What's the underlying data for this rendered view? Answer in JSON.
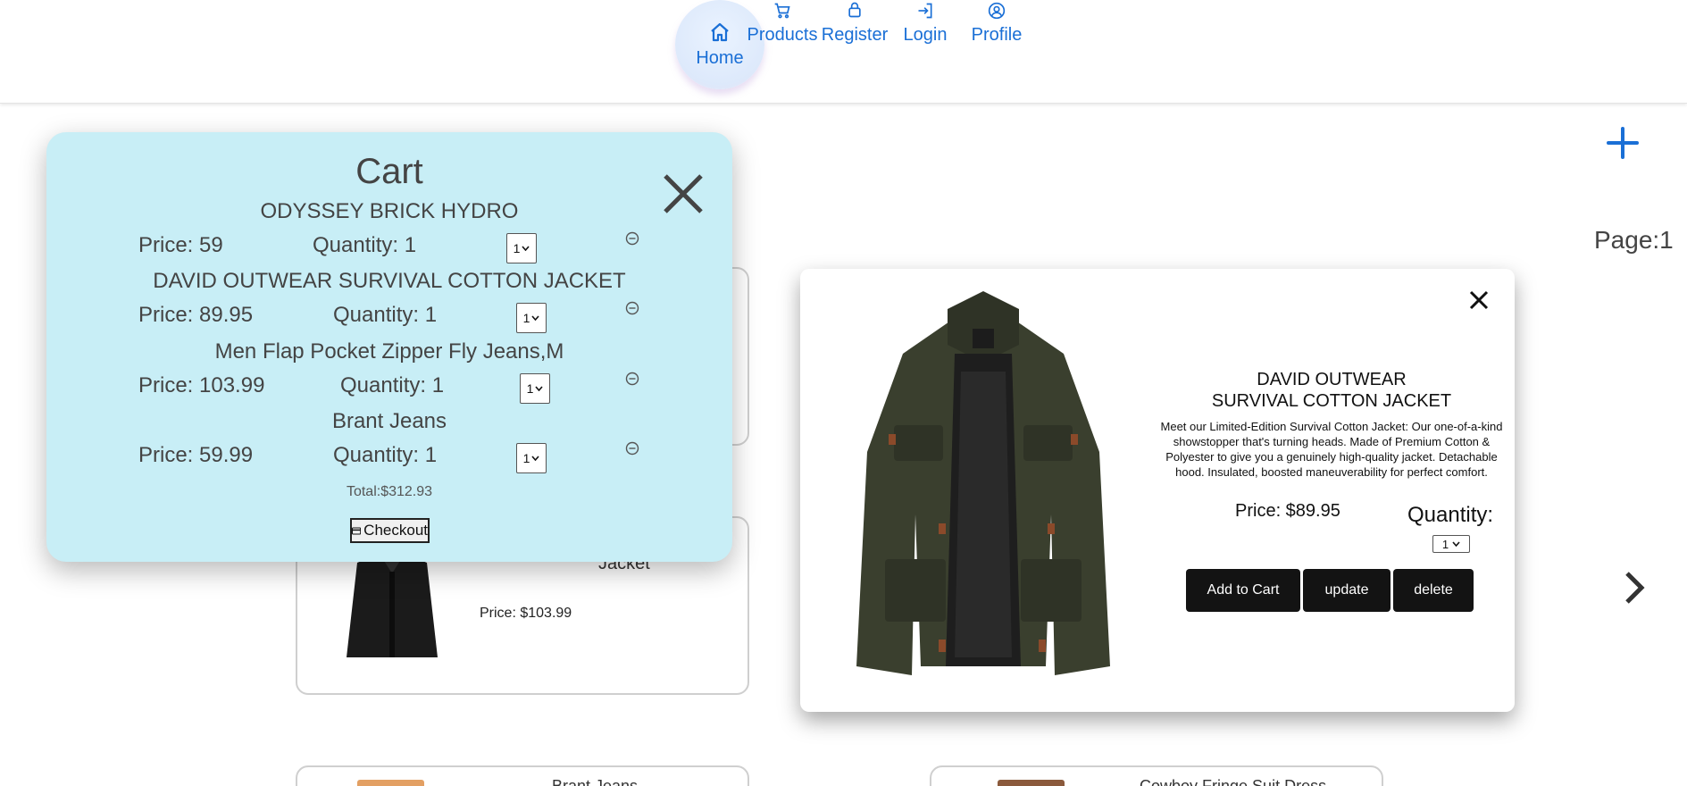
{
  "nav": {
    "home": "Home",
    "products": "Products",
    "register": "Register",
    "login": "Login",
    "profile": "Profile"
  },
  "page": {
    "label": "Page:1"
  },
  "background_cards": {
    "card2_title": "Jacket",
    "card2_price": "Price: $103.99",
    "card3_title": "Brant Jeans",
    "card4_title": "Cowboy Fringe Suit Dress"
  },
  "cart": {
    "title": "Cart",
    "items": [
      {
        "name": "ODYSSEY BRICK HYDRO",
        "price": "Price: 59",
        "quantity": "Quantity: 1",
        "select": "1"
      },
      {
        "name": "DAVID OUTWEAR SURVIVAL COTTON JACKET",
        "price": "Price: 89.95",
        "quantity": "Quantity: 1",
        "select": "1"
      },
      {
        "name": "Men Flap Pocket Zipper Fly Jeans,M",
        "price": "Price: 103.99",
        "quantity": "Quantity: 1",
        "select": "1"
      },
      {
        "name": "Brant Jeans",
        "price": "Price: 59.99",
        "quantity": "Quantity: 1",
        "select": "1"
      }
    ],
    "total": "Total:$312.93",
    "checkout": "Checkout"
  },
  "detail": {
    "title_line1": "DAVID OUTWEAR",
    "title_line2": "SURVIVAL COTTON JACKET",
    "description": "Meet our Limited-Edition Survival Cotton Jacket: Our one-of-a-kind showstopper that's turning heads. Made of Premium Cotton & Polyester to give you a genuinely high-quality jacket. Detachable hood. Insulated, boosted maneuverability for perfect comfort.",
    "price": "Price: $89.95",
    "quantity_label": "Quantity:",
    "quantity_value": "1",
    "add_to_cart": "Add to Cart",
    "update": "update",
    "delete": "delete"
  },
  "colors": {
    "nav_blue": "#1a6fd6",
    "cart_bg": "#c8eef6",
    "button_dark": "#131313"
  }
}
